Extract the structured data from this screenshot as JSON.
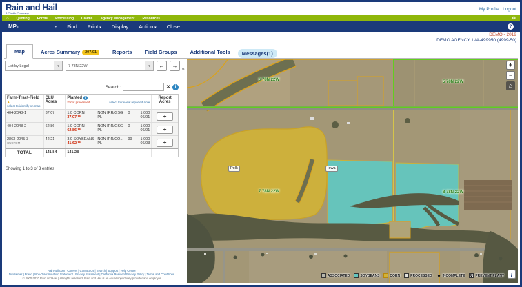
{
  "icons": {
    "home": "⌂",
    "gear": "⚙",
    "help": "?",
    "caret": "▾",
    "prev": "←",
    "next": "→",
    "clear": "✕",
    "info": "i",
    "sort_asc": "▲",
    "collapse": "«",
    "zoom_in": "+",
    "zoom_out": "−",
    "map_home": "⌂",
    "legend_info": "i",
    "sep": "|"
  },
  "header": {
    "logo": {
      "title": "Rain and Hail",
      "subtitle": "A Chubb Company"
    },
    "account": {
      "profile": "My Profile",
      "logout": "Logout"
    },
    "nav": {
      "items": [
        "Quoting",
        "Forms",
        "Processing",
        "Claims",
        "Agency Management",
        "Resources"
      ]
    },
    "toolbar": {
      "policy": "MP-",
      "items": [
        {
          "label": "Find"
        },
        {
          "label": "Print"
        },
        {
          "label": "Display"
        },
        {
          "label": "Action"
        },
        {
          "label": "Close"
        }
      ]
    },
    "context": {
      "demo": "DEMO - 2019",
      "agency": "DEMO AGENCY 1-IA-499950 (4999-50)"
    }
  },
  "tabs": {
    "items": [
      {
        "label": "Map"
      },
      {
        "label": "Acres Summary",
        "badge": "207.01"
      },
      {
        "label": "Reports"
      },
      {
        "label": "Field Groups"
      },
      {
        "label": "Additional Tools"
      },
      {
        "label": "Messages(1)"
      }
    ]
  },
  "sidebar": {
    "list_by": "List by Legal",
    "township": "7 78N 22W",
    "search_label": "Search:",
    "search_value": "",
    "table": {
      "headers": {
        "col1": "Farm-Tract-Field",
        "col1_sub": "select to identify on map",
        "col2": "CLU Acres",
        "col3": "Planted",
        "col3_note": "** not processed",
        "col3_review": "select to review reported acre",
        "col4": "Report Acres"
      },
      "rows": [
        {
          "field": "404-2048-1",
          "sub": "",
          "clu": "37.07",
          "crop": "1.0 CORN",
          "planted": "37.07 **",
          "practice": "NON IRR/GSG",
          "practice2": "PL",
          "unit": "0",
          "share": "1.000",
          "date": "06/01",
          "add": "+"
        },
        {
          "field": "404-2048-2",
          "sub": "",
          "clu": "62.86",
          "crop": "1.0 CORN",
          "planted": "62.86 **",
          "practice": "NON IRR/GSG",
          "practice2": "PL",
          "unit": "0",
          "share": "1.000",
          "date": "06/01",
          "add": "+"
        },
        {
          "field": "2863-2045-3",
          "sub": "CUSTOM",
          "clu": "42.21",
          "crop": "3.0 SOYBEANS",
          "planted": "41.62 **",
          "practice": "NON IRR/CO...",
          "practice2": "PL",
          "unit": "99",
          "share": "1.000",
          "date": "06/03",
          "add": "+"
        }
      ],
      "total": {
        "label": "TOTAL",
        "clu": "141.84",
        "planted": "141.28"
      }
    },
    "showing": "Showing 1 to 3 of 3 entries",
    "footer": {
      "line1": "RainHail.com | Careers | Contact Us | Search | Support | Help Center",
      "line2": "Disclaimer | Fraud | Non-Discrimination Statement | Privacy Statement | California Resident Privacy Policy | Terms and Conditions",
      "line3": "© 2000-2020 Rain and Hail | All rights reserved. Rain and Hail is an equal opportunity provider and employer"
    }
  },
  "map": {
    "sections": [
      "6 78N 22W",
      "5 78N 22W",
      "7 78N 22W",
      "8 78N 22W"
    ],
    "towns": [
      "Polk",
      "Iowa"
    ],
    "legend": [
      {
        "label": "ASSOCIATED"
      },
      {
        "label": "SOYBEANS"
      },
      {
        "label": "CORN"
      },
      {
        "label": "PROCESSED"
      },
      {
        "label": "INCOMPLETE"
      },
      {
        "label": "PREVENT PLANT"
      }
    ],
    "colors": {
      "corn_overlay": "#d2b236",
      "soybean_overlay": "#63c6bf",
      "associated": "#b7b7ad",
      "field_boundary": "#d9a21e",
      "road_highlight": "#62ce1e",
      "section_label": "#2e7d1f"
    }
  }
}
